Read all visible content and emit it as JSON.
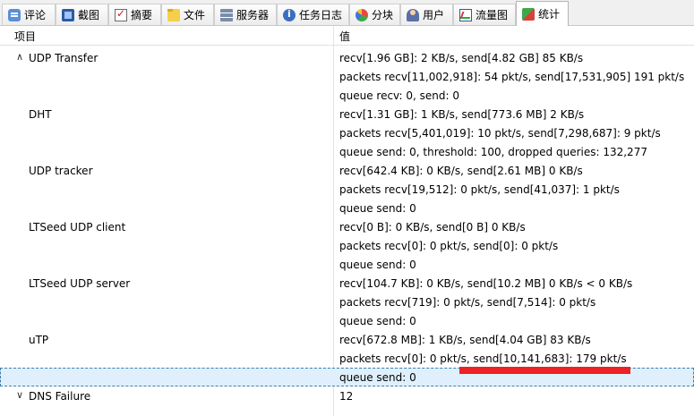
{
  "tabs": [
    {
      "label": "评论",
      "icon": "comment-icon"
    },
    {
      "label": "截图",
      "icon": "screenshot-icon"
    },
    {
      "label": "摘要",
      "icon": "summary-icon"
    },
    {
      "label": "文件",
      "icon": "files-icon"
    },
    {
      "label": "服务器",
      "icon": "servers-icon"
    },
    {
      "label": "任务日志",
      "icon": "log-icon"
    },
    {
      "label": "分块",
      "icon": "pieces-icon"
    },
    {
      "label": "用户",
      "icon": "users-icon"
    },
    {
      "label": "流量图",
      "icon": "graph-icon"
    },
    {
      "label": "统计",
      "icon": "stats-icon"
    }
  ],
  "active_tab": "统计",
  "table": {
    "col_item": "项目",
    "col_value": "值",
    "rows": [
      {
        "item": "UDP Transfer",
        "value": "recv[1.96 GB]: 2 KB/s, send[4.82 GB] 85 KB/s",
        "expanded": true
      },
      {
        "item": "",
        "value": "packets recv[11,002,918]: 54 pkt/s, send[17,531,905] 191 pkt/s"
      },
      {
        "item": "",
        "value": "queue recv: 0, send: 0"
      },
      {
        "item": "DHT",
        "value": "recv[1.31 GB]: 1 KB/s, send[773.6 MB] 2 KB/s"
      },
      {
        "item": "",
        "value": "packets recv[5,401,019]: 10 pkt/s, send[7,298,687]: 9 pkt/s"
      },
      {
        "item": "",
        "value": "queue send: 0, threshold: 100, dropped queries: 132,277"
      },
      {
        "item": "UDP tracker",
        "value": "recv[642.4 KB]: 0 KB/s, send[2.61 MB] 0 KB/s"
      },
      {
        "item": "",
        "value": "packets recv[19,512]: 0 pkt/s, send[41,037]: 1 pkt/s"
      },
      {
        "item": "",
        "value": "queue send: 0"
      },
      {
        "item": "LTSeed UDP client",
        "value": "recv[0 B]: 0 KB/s, send[0 B] 0 KB/s"
      },
      {
        "item": "",
        "value": "packets recv[0]: 0 pkt/s, send[0]: 0 pkt/s"
      },
      {
        "item": "",
        "value": "queue send: 0"
      },
      {
        "item": "LTSeed UDP server",
        "value": "recv[104.7 KB]: 0 KB/s, send[10.2 MB] 0 KB/s < 0 KB/s"
      },
      {
        "item": "",
        "value": "packets recv[719]: 0 pkt/s, send[7,514]: 0 pkt/s"
      },
      {
        "item": "",
        "value": "queue send: 0"
      },
      {
        "item": "uTP",
        "value": "recv[672.8 MB]: 1 KB/s, send[4.04 GB] 83 KB/s"
      },
      {
        "item": "",
        "value": "packets recv[0]: 0 pkt/s, send[10,141,683]: 179 pkt/s"
      },
      {
        "item": "",
        "value": "queue send: 0",
        "selected": true
      },
      {
        "item": "DNS Failure",
        "value": "12",
        "collapsed": true
      }
    ]
  },
  "colors": {
    "selection": "#dff0fc",
    "highlight_mark": "#ee2124"
  }
}
